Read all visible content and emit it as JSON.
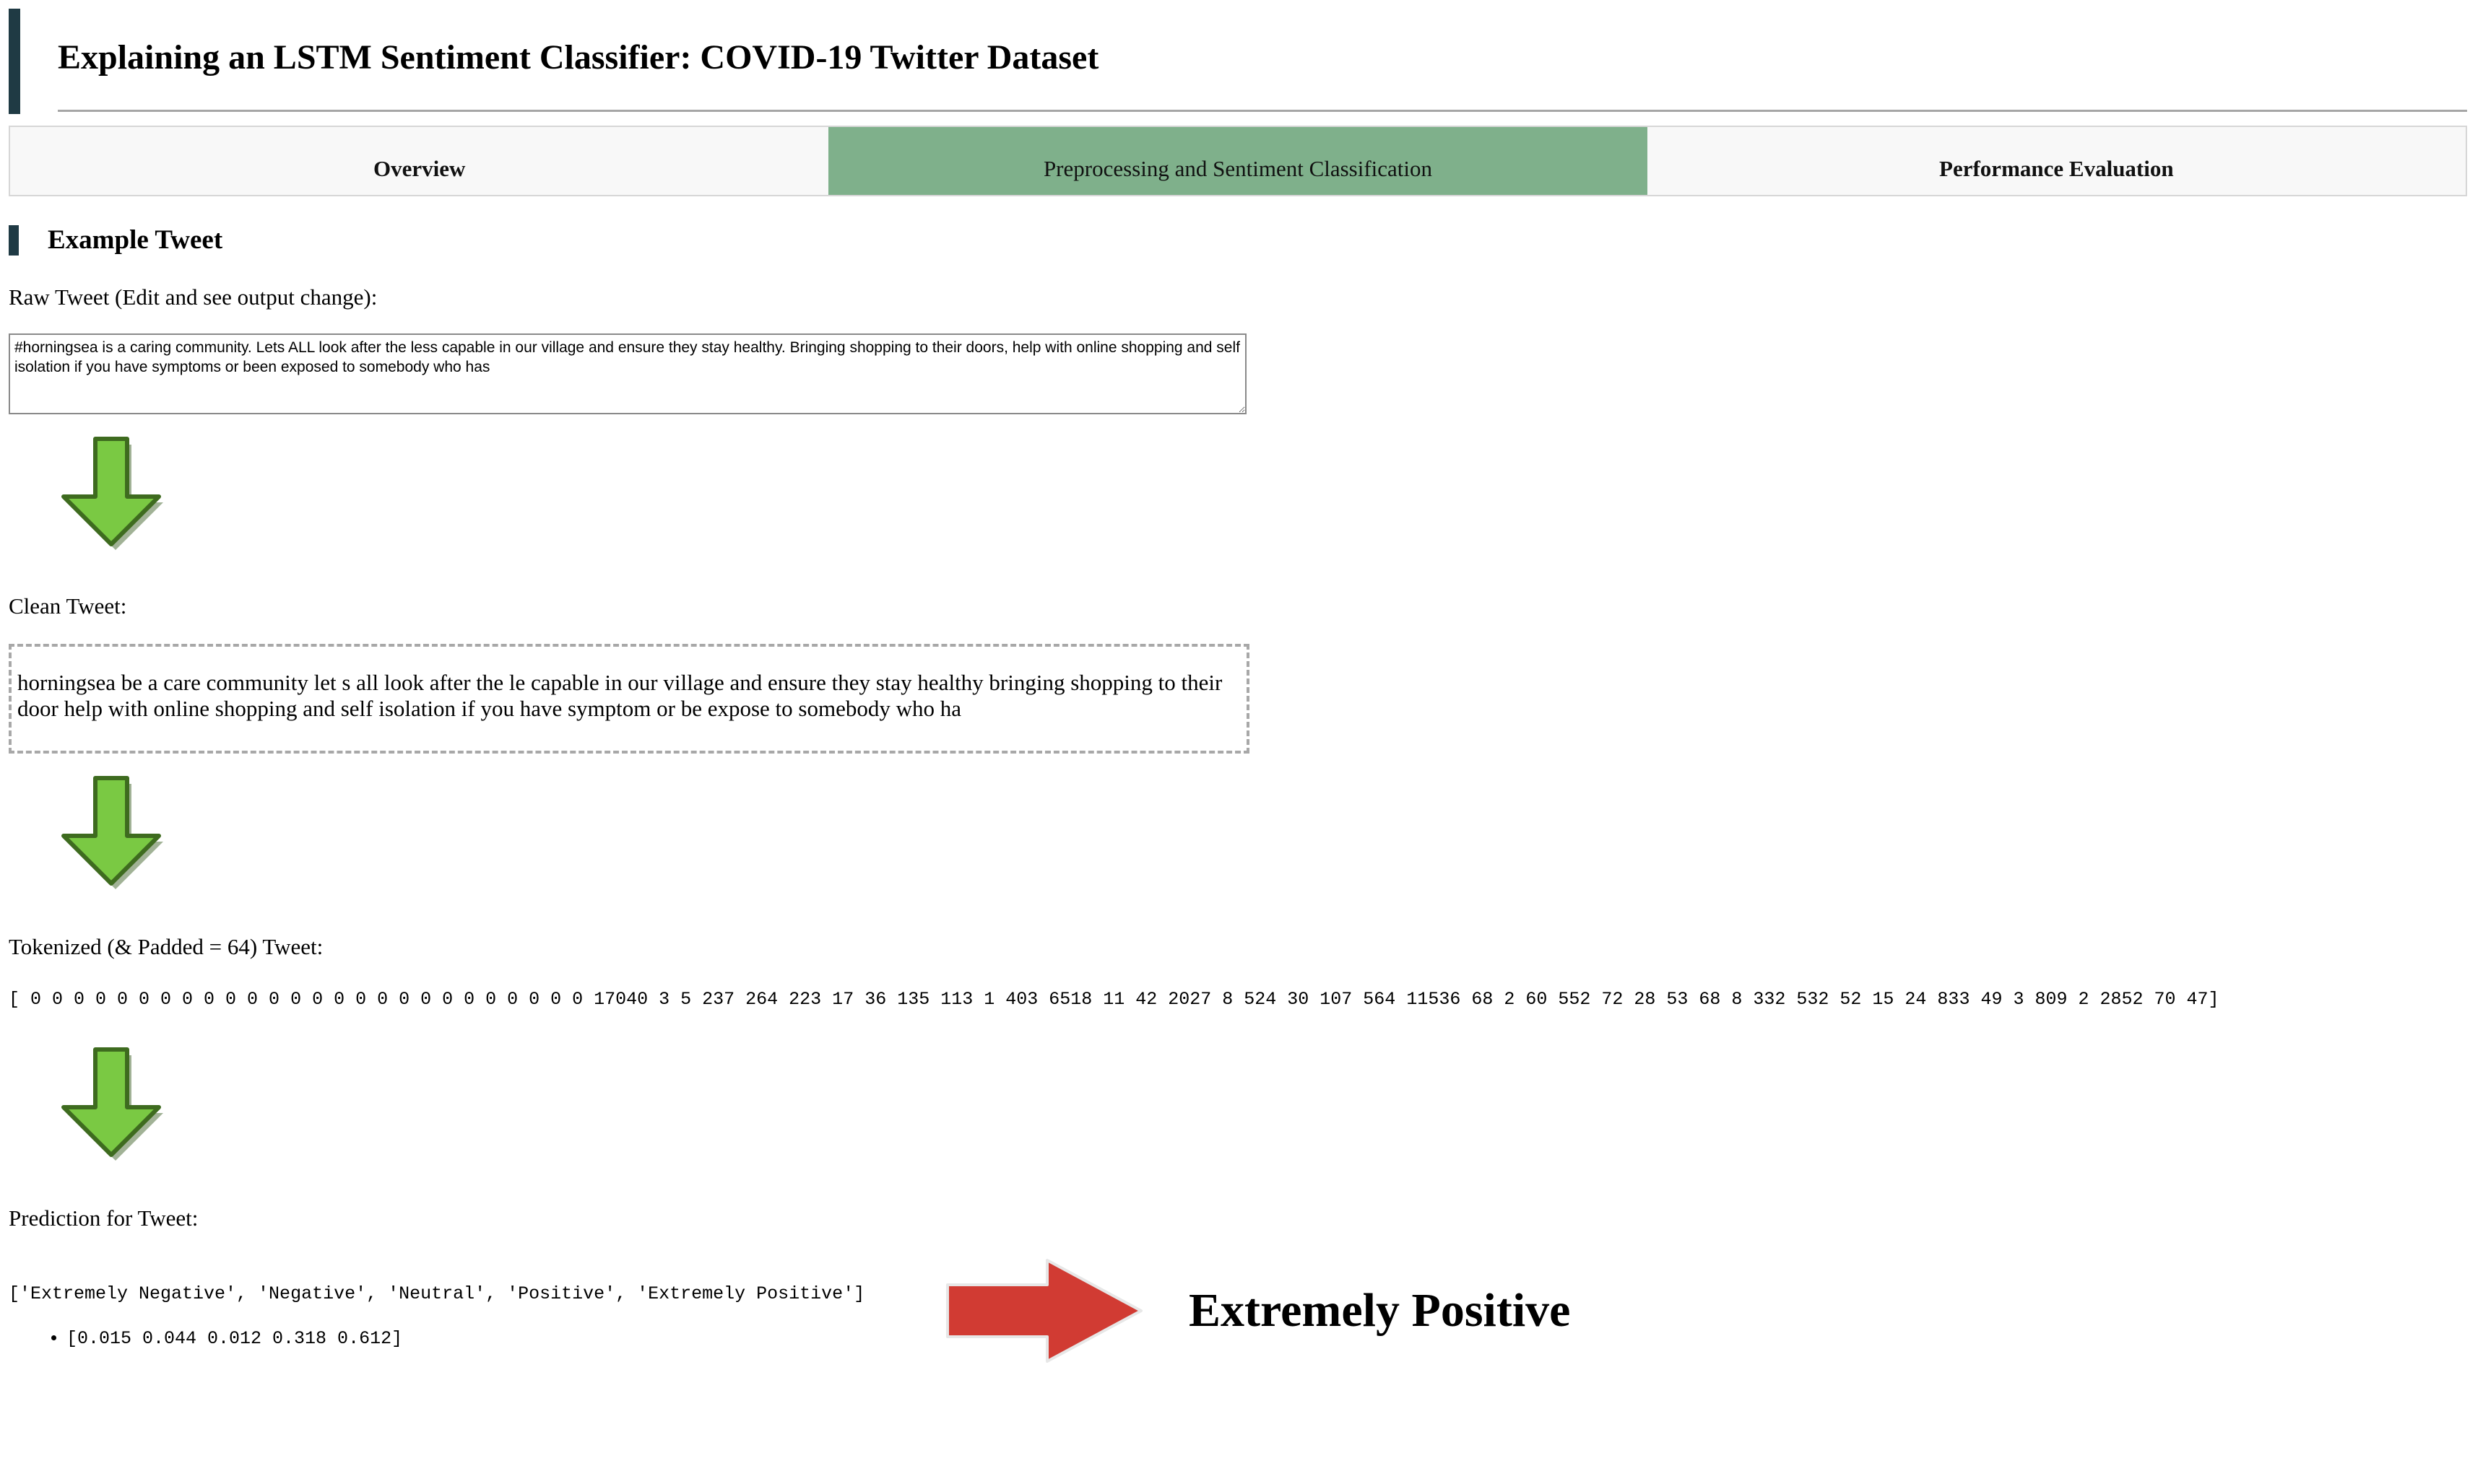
{
  "header": {
    "title": "Explaining an LSTM Sentiment Classifier: COVID-19 Twitter Dataset"
  },
  "tabs": [
    {
      "label": "Overview",
      "active": false
    },
    {
      "label": "Preprocessing and Sentiment Classification",
      "active": true
    },
    {
      "label": "Performance Evaluation",
      "active": false
    }
  ],
  "colors": {
    "accent_bar": "#1f3a44",
    "active_tab": "#7fb08b",
    "down_arrow": "#7ac943",
    "right_arrow": "#d13b33"
  },
  "section": {
    "heading": "Example Tweet"
  },
  "raw_tweet": {
    "label": "Raw Tweet (Edit and see output change):",
    "value": "#horningsea is a caring community. Lets ALL look after the less capable in our village and ensure they stay healthy. Bringing shopping to their doors, help with online shopping and self isolation if you have symptoms or been exposed to somebody who has"
  },
  "clean_tweet": {
    "label": "Clean Tweet:",
    "value": "horningsea be a care community let s all look after the le capable in our village and ensure they stay healthy bringing shopping to their door help with online shopping and self isolation if you have symptom or be expose to somebody who ha"
  },
  "tokenized": {
    "label": "Tokenized (& Padded = 64) Tweet:",
    "value": "[ 0  0  0  0  0  0  0  0  0  0  0  0  0  0  0  0  0  0  0  0  0  0  0  0  0  0  17040  3  5  237  264  223  17  36  135  113  1  403  6518  11  42  2027  8  524  30  107  564  11536  68  2  60  552  72  28  53  68  8  332  532  52  15  24  833  49  3  809  2  2852  70  47]"
  },
  "prediction": {
    "label": "Prediction for Tweet:",
    "classes": "['Extremely Negative', 'Negative', 'Neutral', 'Positive', 'Extremely Positive']",
    "probabilities": "[0.015 0.044 0.012 0.318 0.612]",
    "result": "Extremely Positive"
  },
  "icons": {
    "down_arrow": "arrow-down-icon",
    "right_arrow": "arrow-right-icon"
  }
}
